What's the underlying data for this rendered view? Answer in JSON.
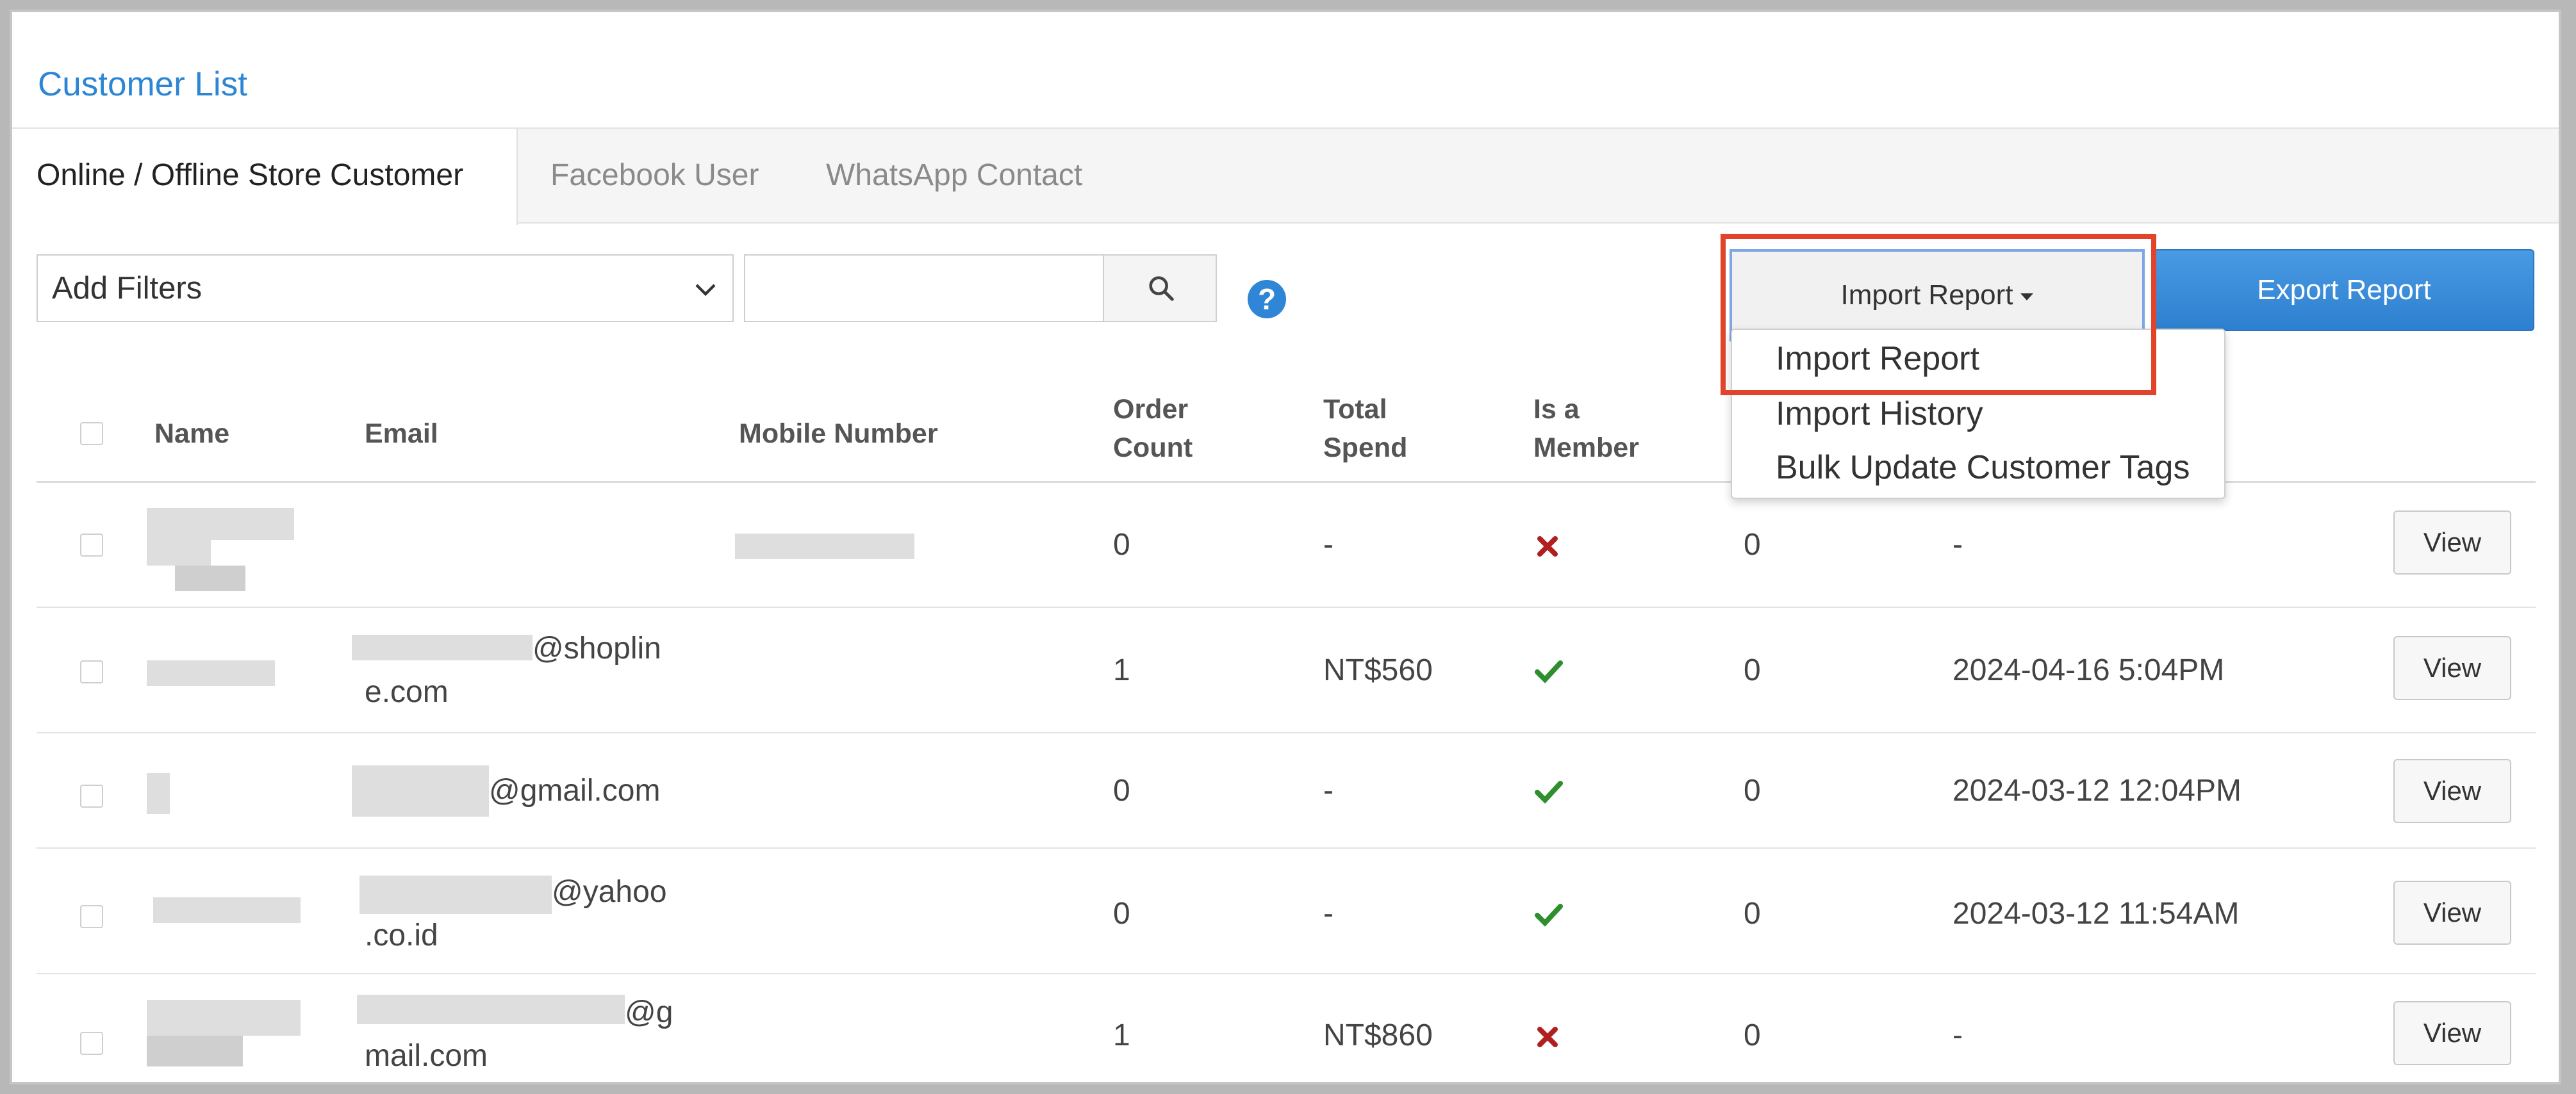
{
  "title": "Customer List",
  "tabs": [
    {
      "label": "Online / Offline Store Customer"
    },
    {
      "label": "Facebook User"
    },
    {
      "label": "WhatsApp Contact"
    }
  ],
  "filters": {
    "select_label": "Add Filters",
    "search_value": "",
    "help_icon": "?"
  },
  "actions": {
    "import_label": "Import Report",
    "export_label": "Export Report"
  },
  "dropdown": {
    "items": [
      {
        "label": "Import Report"
      },
      {
        "label": "Import History"
      },
      {
        "label": "Bulk Update Customer Tags"
      }
    ]
  },
  "table": {
    "columns": [
      {
        "label": "Name"
      },
      {
        "label": "Email"
      },
      {
        "label": "Mobile Number"
      },
      {
        "label": "Order Count"
      },
      {
        "label": "Total Spend"
      },
      {
        "label": "Is a Member"
      }
    ],
    "rows": [
      {
        "email_part1": "",
        "email_part2": "",
        "orders": "0",
        "spend": "-",
        "member": "no",
        "points": "0",
        "date": "-",
        "view_label": "View"
      },
      {
        "email_part1": "@shoplin",
        "email_part2": "e.com",
        "orders": "1",
        "spend": "NT$560",
        "member": "yes",
        "points": "0",
        "date": "2024-04-16 5:04PM",
        "view_label": "View"
      },
      {
        "email_part1": "@gmail.com",
        "email_part2": "",
        "orders": "0",
        "spend": "-",
        "member": "yes",
        "points": "0",
        "date": "2024-03-12 12:04PM",
        "view_label": "View"
      },
      {
        "email_part1": "@yahoo",
        "email_part2": ".co.id",
        "orders": "0",
        "spend": "-",
        "member": "yes",
        "points": "0",
        "date": "2024-03-12 11:54AM",
        "view_label": "View"
      },
      {
        "email_part1": "@g",
        "email_part2": "mail.com",
        "orders": "1",
        "spend": "NT$860",
        "member": "no",
        "points": "0",
        "date": "-",
        "view_label": "View"
      }
    ]
  },
  "colors": {
    "accent": "#2c86d4",
    "highlight": "#e2442b",
    "member_yes": "#2f8f2f",
    "member_no": "#b02020"
  },
  "icons": {
    "search": "search-icon",
    "help": "help-icon",
    "dropdown": "chevron-down-icon",
    "member_yes": "check-icon",
    "member_no": "cross-icon"
  }
}
